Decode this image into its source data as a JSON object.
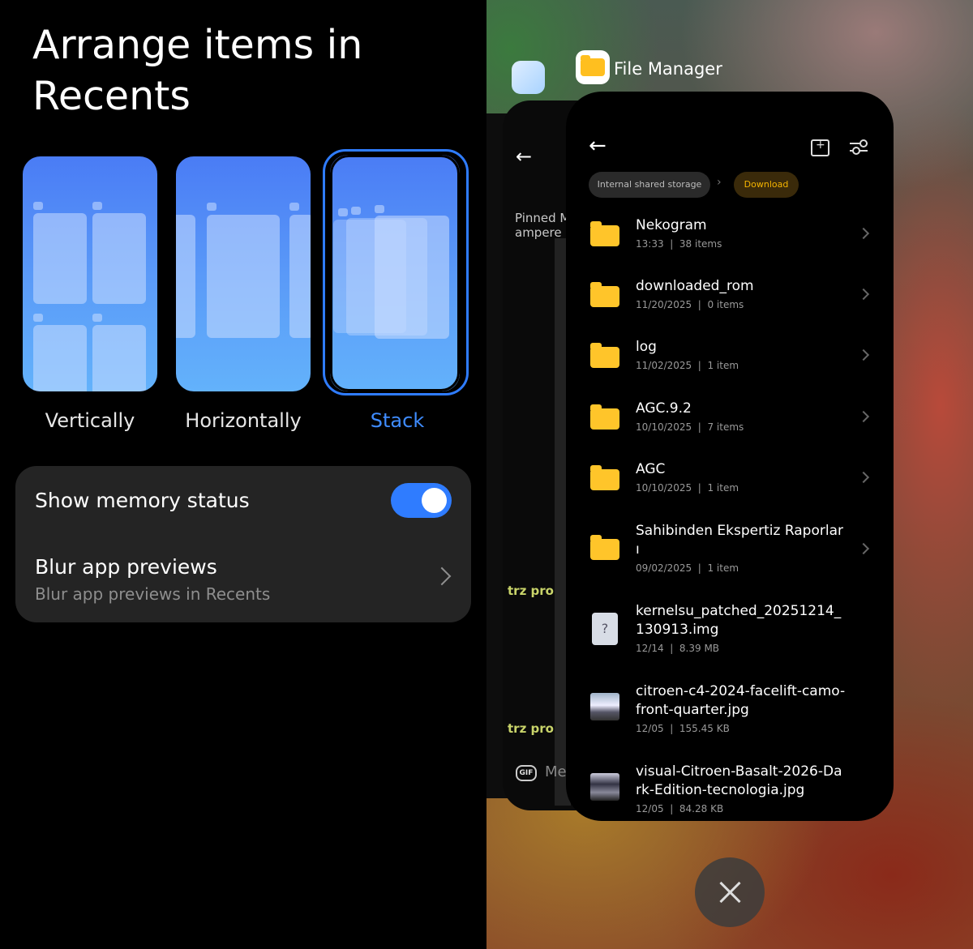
{
  "settings": {
    "title": "Arrange items in Recents",
    "options": [
      {
        "label": "Vertically",
        "selected": false
      },
      {
        "label": "Horizontally",
        "selected": false
      },
      {
        "label": "Stack",
        "selected": true
      }
    ],
    "memory_status": {
      "label": "Show memory status",
      "enabled": true
    },
    "blur": {
      "label": "Blur app previews",
      "sublabel": "Blur app previews in Recents"
    }
  },
  "recents": {
    "file_manager": {
      "app_name": "File Manager",
      "breadcrumb": [
        "Internal shared storage",
        "Download"
      ],
      "items": [
        {
          "name": "Nekogram",
          "date": "13:33",
          "detail": "38 items",
          "type": "folder"
        },
        {
          "name": "downloaded_rom",
          "date": "11/20/2025",
          "detail": "0 items",
          "type": "folder"
        },
        {
          "name": "log",
          "date": "11/02/2025",
          "detail": "1 item",
          "type": "folder"
        },
        {
          "name": "AGC.9.2",
          "date": "10/10/2025",
          "detail": "7 items",
          "type": "folder"
        },
        {
          "name": "AGC",
          "date": "10/10/2025",
          "detail": "1 item",
          "type": "folder"
        },
        {
          "name": "Sahibinden Ekspertiz Raporları",
          "date": "09/02/2025",
          "detail": "1 item",
          "type": "folder"
        },
        {
          "name": "kernelsu_patched_20251214_130913.img",
          "date": "12/14",
          "detail": "8.39 MB",
          "type": "unknown"
        },
        {
          "name": "citroen-c4-2024-facelift-camo-front-quarter.jpg",
          "date": "12/05",
          "detail": "155.45 KB",
          "type": "image"
        },
        {
          "name": "visual-Citroen-Basalt-2026-Dark-Edition-tecnologia.jpg",
          "date": "12/05",
          "detail": "84.28 KB",
          "type": "image"
        }
      ]
    },
    "chat_app": {
      "pinned_title": "Pinned M",
      "pinned_sub": "ampere re",
      "logo_text": "trz pro",
      "gif_label": "GIF",
      "input_placeholder": "Me"
    }
  }
}
